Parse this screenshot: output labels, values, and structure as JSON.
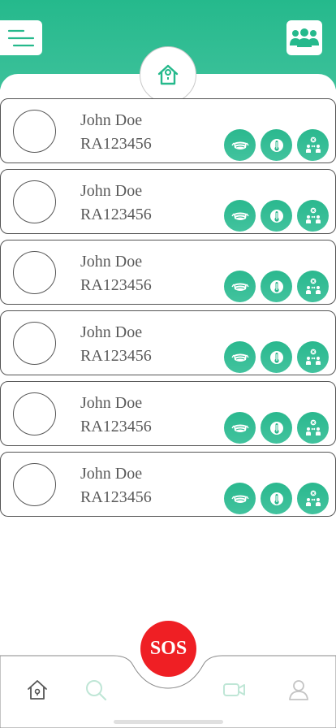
{
  "header": {
    "menu_icon": "menu-lines-icon",
    "group_icon": "group-users-icon",
    "home_icon": "home-icon",
    "accent_color": "#25b98c"
  },
  "people": [
    {
      "name": "John Doe",
      "code": "RA123456"
    },
    {
      "name": "John Doe",
      "code": "RA123456"
    },
    {
      "name": "John Doe",
      "code": "RA123456"
    },
    {
      "name": "John Doe",
      "code": "RA123456"
    },
    {
      "name": "John Doe",
      "code": "RA123456"
    },
    {
      "name": "John Doe",
      "code": "RA123456"
    }
  ],
  "card_actions": [
    "mask-icon",
    "thermometer-icon",
    "social-distance-icon"
  ],
  "bottom_nav": {
    "sos_label": "SOS",
    "sos_color": "#ef1f24",
    "items": [
      "home-icon",
      "search-icon",
      "video-icon",
      "profile-icon"
    ]
  }
}
